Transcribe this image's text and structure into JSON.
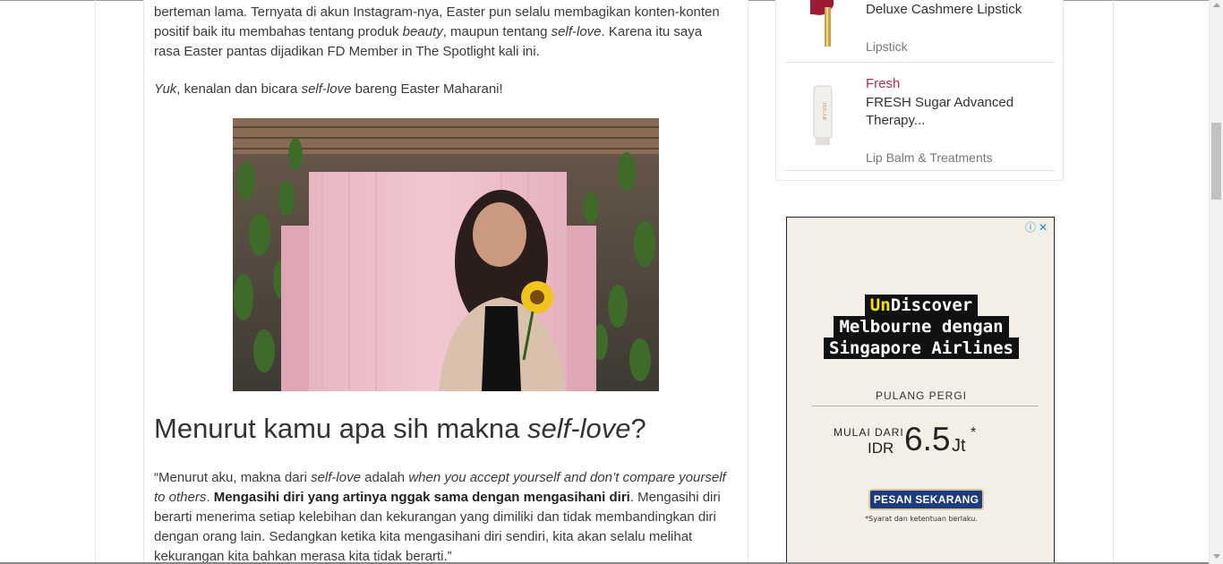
{
  "article": {
    "p1": [
      {
        "t": "berteman lama. Ternyata di akun Instagram-nya, Easter pun selalu membagikan konten-konten positif baik itu membahas tentang produk "
      },
      {
        "t": "beauty",
        "i": true
      },
      {
        "t": ", maupun tentang "
      },
      {
        "t": "self-love",
        "i": true
      },
      {
        "t": ". Karena itu saya rasa Easter pantas dijadikan FD Member in The Spotlight kali ini."
      }
    ],
    "p2": [
      {
        "t": "Yuk",
        "i": true
      },
      {
        "t": ", kenalan dan bicara "
      },
      {
        "t": "self-love",
        "i": true
      },
      {
        "t": " bareng Easter Maharani!"
      }
    ],
    "heading_main": "Menurut kamu apa sih makna ",
    "heading_italic": "self-love",
    "heading_end": "?",
    "p3": [
      {
        "t": "“Menurut aku, makna dari "
      },
      {
        "t": "self-love",
        "i": true
      },
      {
        "t": " adalah "
      },
      {
        "t": "when you accept yourself and don’t compare yourself to others",
        "i": true
      },
      {
        "t": ". "
      },
      {
        "t": "Mengasihi diri yang artinya nggak sama dengan mengasihani diri",
        "b": true
      },
      {
        "t": ". Mengasihi diri berarti menerima setiap kelebihan dan kekurangan yang dimiliki dan tidak membandingkan diri dengan orang lain. Sedangkan ketika kita mengasihani diri sendiri, kita akan selalu melihat kekurangan kita bahkan merasa kita tidak berarti.”"
      }
    ]
  },
  "sidebar": {
    "products": [
      {
        "brand": "",
        "name": "Deluxe Cashmere Lipstick",
        "category": "Lipstick",
        "image_icon": "lipstick-icon"
      },
      {
        "brand": "Fresh",
        "name": "FRESH Sugar Advanced Therapy...",
        "category": "Lip Balm & Treatments",
        "image_icon": "lip-balm-icon",
        "image_text": "SUGAR"
      }
    ]
  },
  "ad": {
    "headline_hl": "Un",
    "headline_l1": "Discover",
    "headline_l2": "Melbourne dengan",
    "headline_l3": "Singapore Airlines",
    "roundtrip": "PULANG PERGI",
    "from": "MULAI DARI",
    "currency": "IDR",
    "price": "6.5",
    "unit": "Jt",
    "asterisk": "*",
    "cta": "PESAN SEKARANG",
    "terms": "*Syarat dan ketentuan berlaku.",
    "icons": "ⓘ✕"
  },
  "colors": {
    "brand": "#b02c4f",
    "ad_cta": "#1f3b80",
    "ad_highlight": "#f2e600",
    "ad_bg": "#f3efe6"
  }
}
